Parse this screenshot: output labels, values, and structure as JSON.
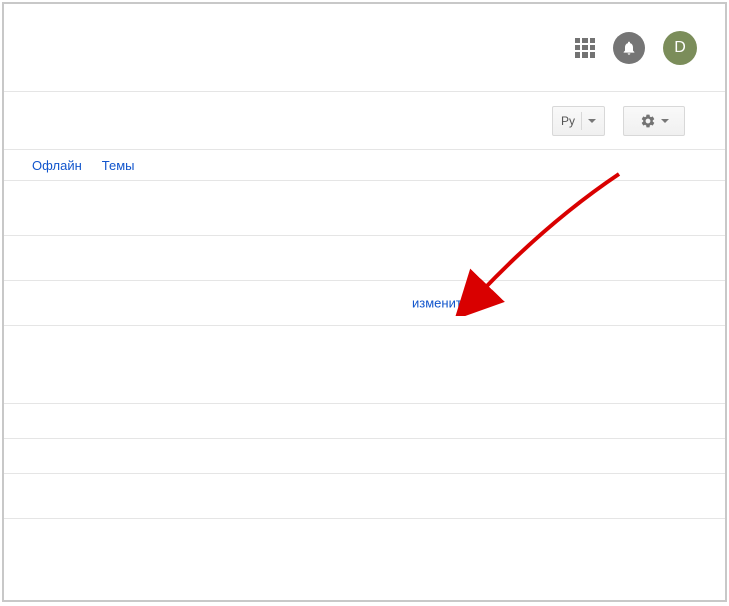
{
  "header": {
    "avatar_letter": "D"
  },
  "toolbar": {
    "lang_label": "Ру"
  },
  "tabs": {
    "offline": "Офлайн",
    "themes": "Темы"
  },
  "content": {
    "edit_link": "изменить"
  },
  "colors": {
    "link": "#1155cc",
    "avatar": "#7b8d5a",
    "arrow": "#d90000"
  }
}
